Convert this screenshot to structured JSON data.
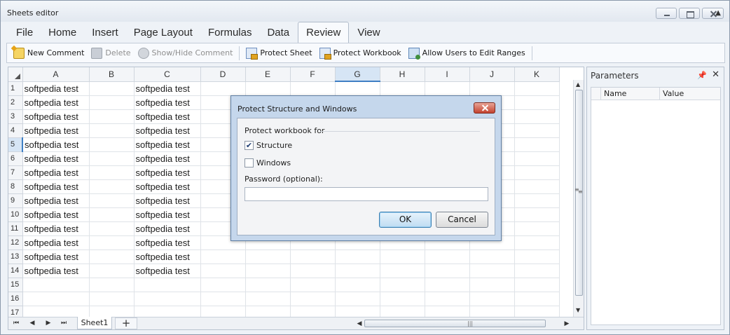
{
  "window": {
    "title": "Sheets editor"
  },
  "ribbon": {
    "tabs": [
      {
        "label": "File"
      },
      {
        "label": "Home"
      },
      {
        "label": "Insert"
      },
      {
        "label": "Page Layout"
      },
      {
        "label": "Formulas"
      },
      {
        "label": "Data"
      },
      {
        "label": "Review",
        "active": true
      },
      {
        "label": "View"
      }
    ],
    "toolbar": {
      "new_comment": "New Comment",
      "delete": "Delete",
      "show_hide_comment": "Show/Hide Comment",
      "protect_sheet": "Protect Sheet",
      "protect_workbook": "Protect Workbook",
      "allow_users": "Allow Users to Edit Ranges"
    }
  },
  "grid": {
    "columns": [
      "A",
      "B",
      "C",
      "D",
      "E",
      "F",
      "G",
      "H",
      "I",
      "J",
      "K"
    ],
    "selected_column": "G",
    "selected_row": 5,
    "rows": [
      {
        "n": "1",
        "A": "softpedia test",
        "C": "softpedia test"
      },
      {
        "n": "2",
        "A": "softpedia test",
        "C": "softpedia test"
      },
      {
        "n": "3",
        "A": "softpedia test",
        "C": "softpedia test"
      },
      {
        "n": "4",
        "A": "softpedia test",
        "C": "softpedia test"
      },
      {
        "n": "5",
        "A": "softpedia test",
        "C": "softpedia test"
      },
      {
        "n": "6",
        "A": "softpedia test",
        "C": "softpedia test"
      },
      {
        "n": "7",
        "A": "softpedia test",
        "C": "softpedia test"
      },
      {
        "n": "8",
        "A": "softpedia test",
        "C": "softpedia test"
      },
      {
        "n": "9",
        "A": "softpedia test",
        "C": "softpedia test"
      },
      {
        "n": "10",
        "A": "softpedia test",
        "C": "softpedia test"
      },
      {
        "n": "11",
        "A": "softpedia test",
        "C": "softpedia test"
      },
      {
        "n": "12",
        "A": "softpedia test",
        "C": "softpedia test"
      },
      {
        "n": "13",
        "A": "softpedia test",
        "C": "softpedia test"
      },
      {
        "n": "14",
        "A": "softpedia test",
        "C": "softpedia test"
      },
      {
        "n": "15"
      },
      {
        "n": "16"
      },
      {
        "n": "17"
      }
    ]
  },
  "sheets": {
    "active": "Sheet1",
    "add_label": "+"
  },
  "panel": {
    "title": "Parameters",
    "pin_icon": "pin-icon",
    "columns": [
      "Name",
      "Value"
    ]
  },
  "dialog": {
    "title": "Protect Structure and Windows",
    "group_label": "Protect workbook for",
    "structure_label": "Structure",
    "structure_checked": true,
    "windows_label": "Windows",
    "windows_checked": false,
    "password_label": "Password (optional):",
    "password_value": "",
    "ok_label": "OK",
    "cancel_label": "Cancel"
  }
}
